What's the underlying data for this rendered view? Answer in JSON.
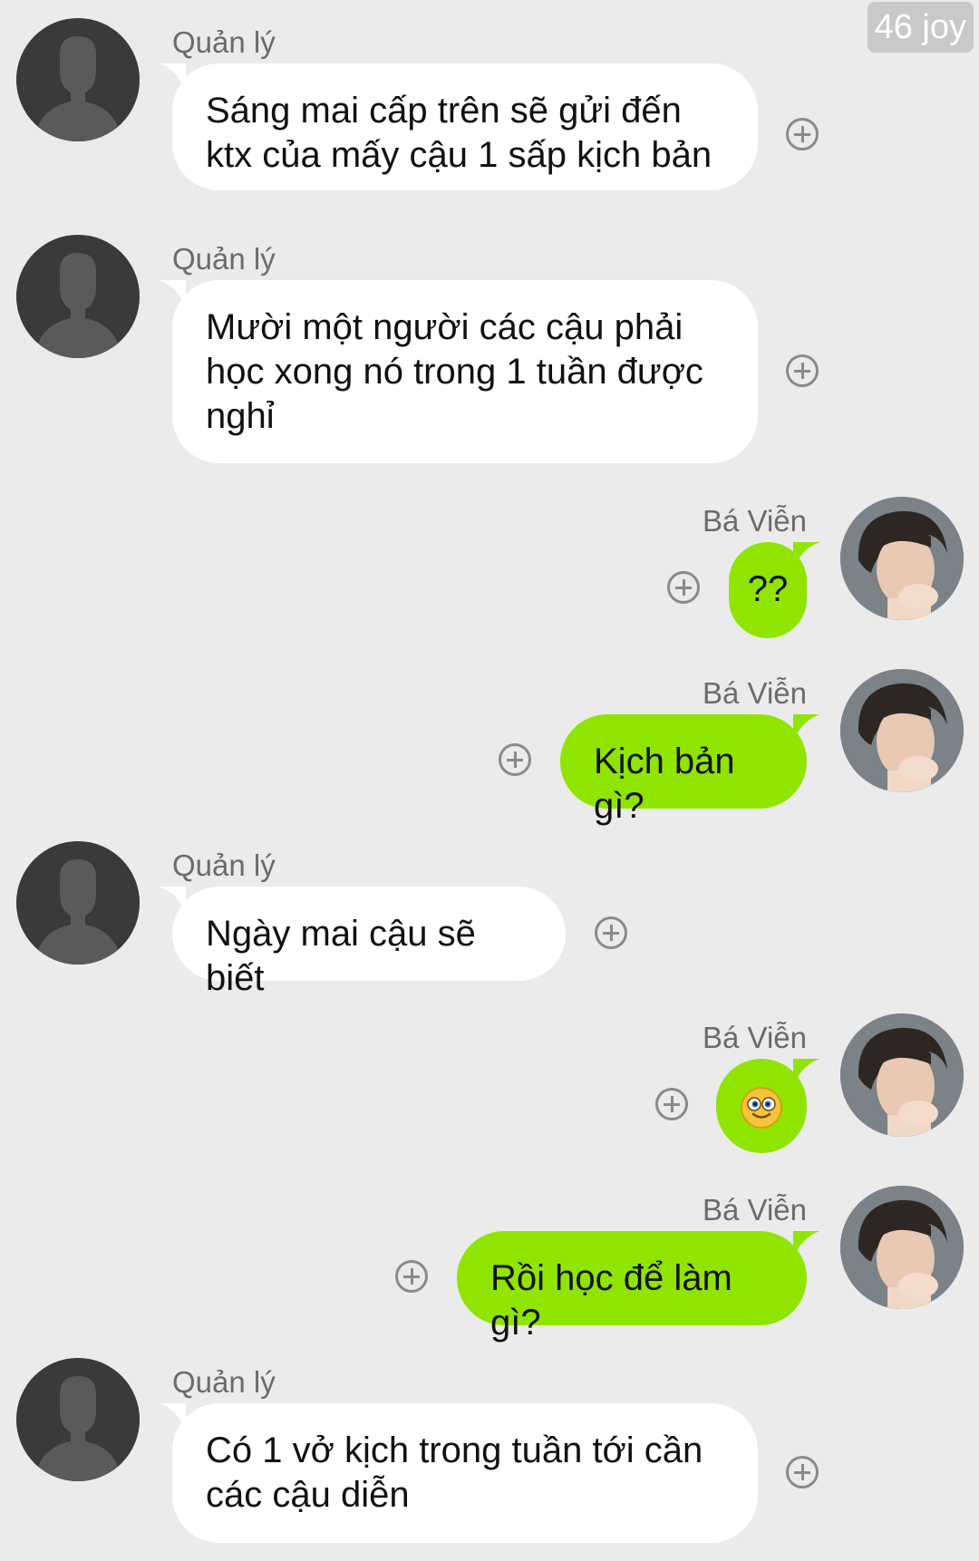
{
  "watermark": "46 joy",
  "colors": {
    "background": "#ebebeb",
    "incoming_bubble": "#ffffff",
    "outgoing_bubble": "#8fe500",
    "sender_text": "#6b6b6b"
  },
  "messages": [
    {
      "direction": "incoming",
      "sender": "Quản lý",
      "lines": [
        "Sáng mai cấp trên sẽ gửi đến",
        "ktx của mấy cậu 1 sấp kịch bản"
      ]
    },
    {
      "direction": "incoming",
      "sender": "Quản lý",
      "lines": [
        "Mười một người các cậu phải",
        "học xong nó trong 1 tuần được",
        "nghỉ"
      ]
    },
    {
      "direction": "outgoing",
      "sender": "Bá Viễn",
      "lines": [
        "??"
      ]
    },
    {
      "direction": "outgoing",
      "sender": "Bá Viễn",
      "lines": [
        "Kịch bản gì?"
      ]
    },
    {
      "direction": "incoming",
      "sender": "Quản lý",
      "lines": [
        "Ngày mai cậu sẽ biết"
      ]
    },
    {
      "direction": "outgoing",
      "sender": "Bá Viễn",
      "emoji": "wide-eyed-smile-emoji"
    },
    {
      "direction": "outgoing",
      "sender": "Bá Viễn",
      "lines": [
        "Rồi học để làm gì?"
      ]
    },
    {
      "direction": "incoming",
      "sender": "Quản lý",
      "lines": [
        "Có 1 vở kịch trong tuần tới cần",
        "các cậu diễn"
      ]
    }
  ]
}
